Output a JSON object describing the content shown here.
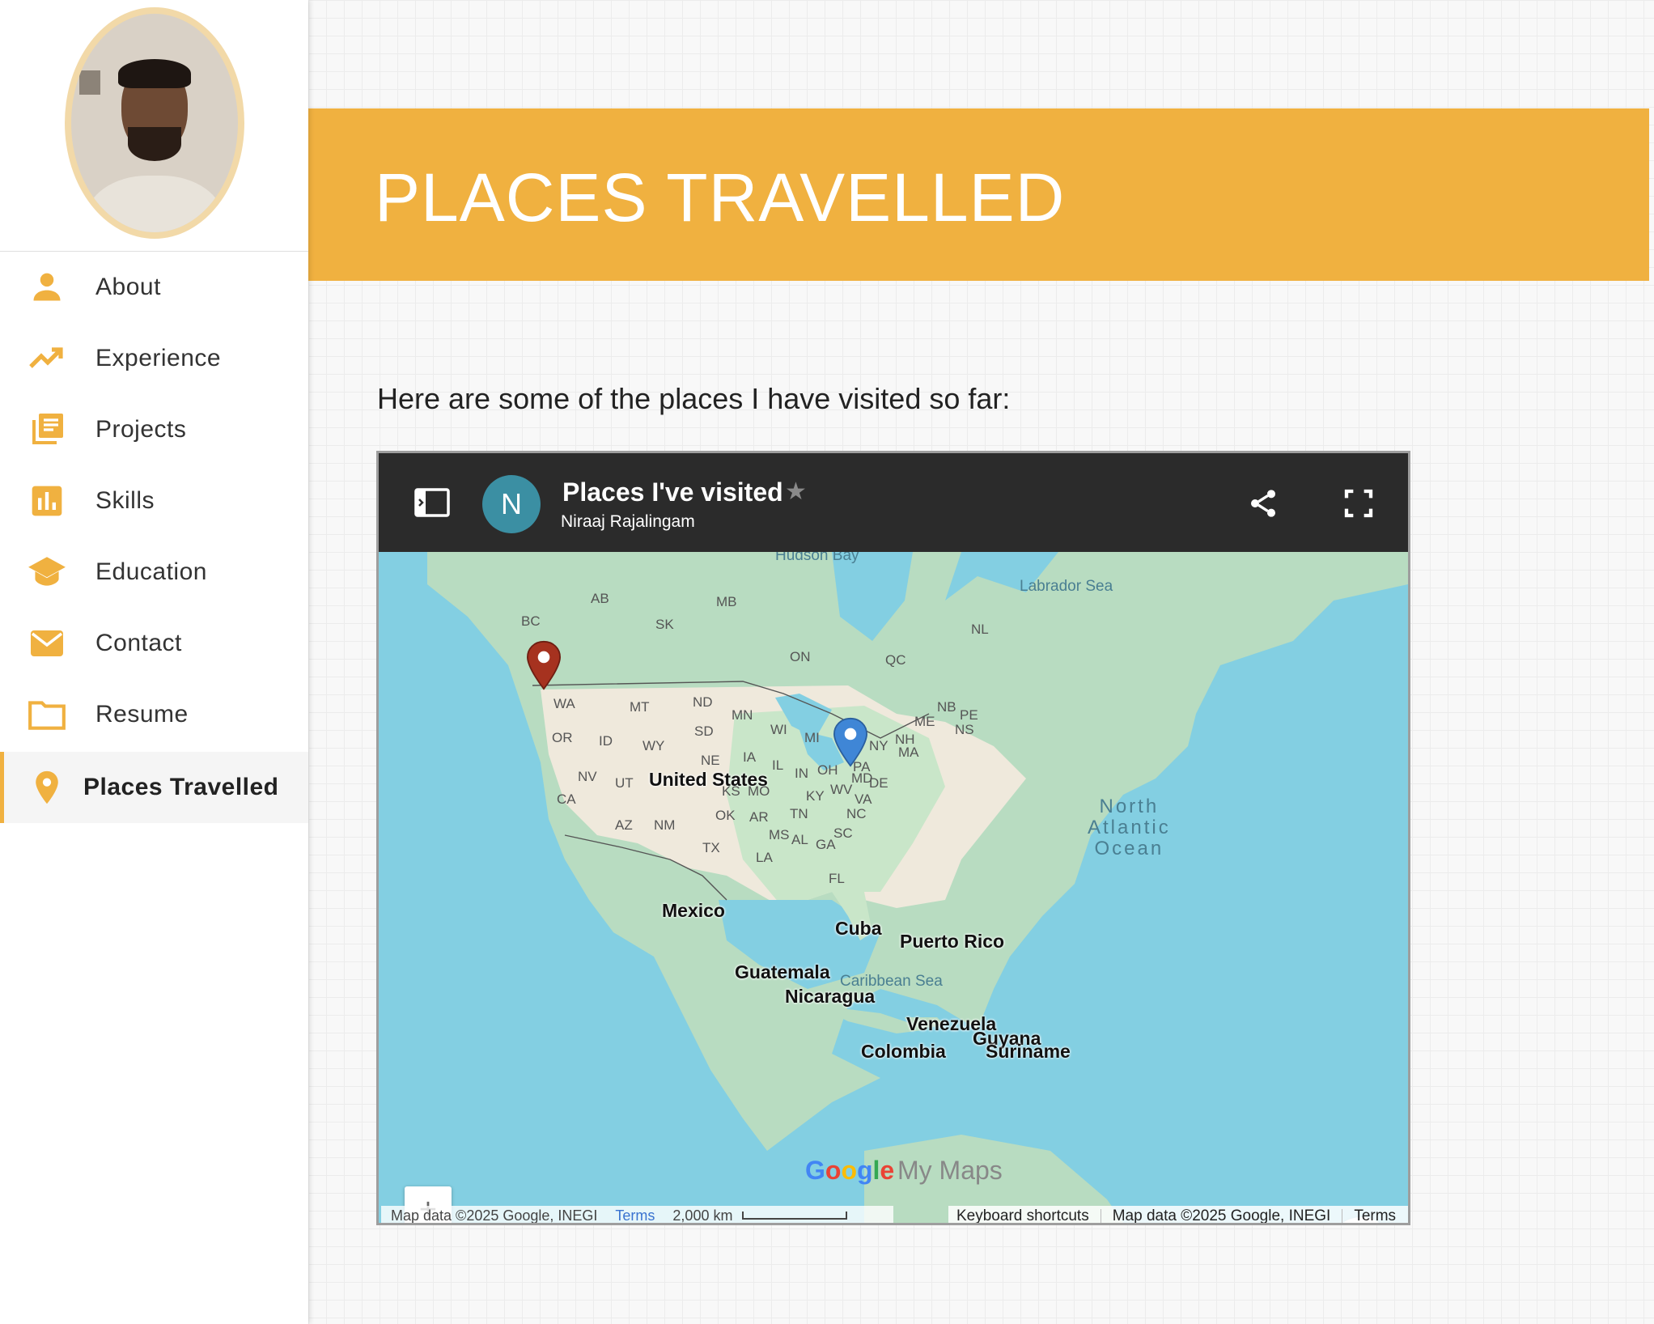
{
  "sidebar": {
    "items": [
      {
        "label": "About",
        "icon": "person-icon"
      },
      {
        "label": "Experience",
        "icon": "trending-up-icon"
      },
      {
        "label": "Projects",
        "icon": "library-books-icon"
      },
      {
        "label": "Skills",
        "icon": "bar-chart-icon"
      },
      {
        "label": "Education",
        "icon": "graduation-cap-icon"
      },
      {
        "label": "Contact",
        "icon": "mail-icon"
      },
      {
        "label": "Resume",
        "icon": "folder-icon"
      },
      {
        "label": "Places Travelled",
        "icon": "location-pin-icon",
        "active": true
      }
    ],
    "accent": "#f0b140"
  },
  "main": {
    "banner_title": "PLACES TRAVELLED",
    "banner_color": "#f0b140",
    "intro": "Here are some of the places I have visited so far:"
  },
  "map": {
    "title": "Places I've visited",
    "owner_initial": "N",
    "author": "Niraaj Rajalingam",
    "zoom_in": "+",
    "zoom_out": "−",
    "logo_google": "Google",
    "logo_mymaps": "My Maps",
    "attribution_left": "Map data ©2025 Google, INEGI",
    "terms_left": "Terms",
    "scale": "2,000 km",
    "keyboard_shortcuts": "Keyboard shortcuts",
    "attribution_right": "Map data ©2025 Google, INEGI",
    "terms_right": "Terms",
    "labels": {
      "hudson_bay": "Hudson Bay",
      "labrador_sea": "Labrador Sea",
      "ocean_1": "North",
      "ocean_2": "Atlantic",
      "ocean_3": "Ocean",
      "caribbean": "Caribbean Sea",
      "us": "United States",
      "mexico": "Mexico",
      "cuba": "Cuba",
      "puerto_rico": "Puerto Rico",
      "guatemala": "Guatemala",
      "nicaragua": "Nicaragua",
      "venezuela": "Venezuela",
      "guyana": "Guyana",
      "colombia": "Colombia",
      "suriname": "Suriname",
      "states": [
        "AB",
        "MB",
        "BC",
        "SK",
        "ON",
        "QC",
        "NL",
        "NB",
        "PE",
        "NS",
        "ME",
        "NH",
        "MA",
        "NY",
        "PA",
        "MD",
        "DE",
        "VA",
        "WV",
        "OH",
        "MI",
        "WI",
        "MN",
        "ND",
        "SD",
        "NE",
        "IA",
        "IL",
        "IN",
        "KY",
        "TN",
        "NC",
        "SC",
        "GA",
        "AL",
        "MS",
        "LA",
        "AR",
        "MO",
        "OK",
        "TX",
        "KS",
        "NM",
        "AZ",
        "UT",
        "NV",
        "CA",
        "OR",
        "WA",
        "ID",
        "MT",
        "WY",
        "FL"
      ]
    },
    "pins": [
      {
        "name": "red-pin",
        "color": "#a6321f"
      },
      {
        "name": "blue-pin",
        "color": "#3f86d6"
      }
    ]
  }
}
